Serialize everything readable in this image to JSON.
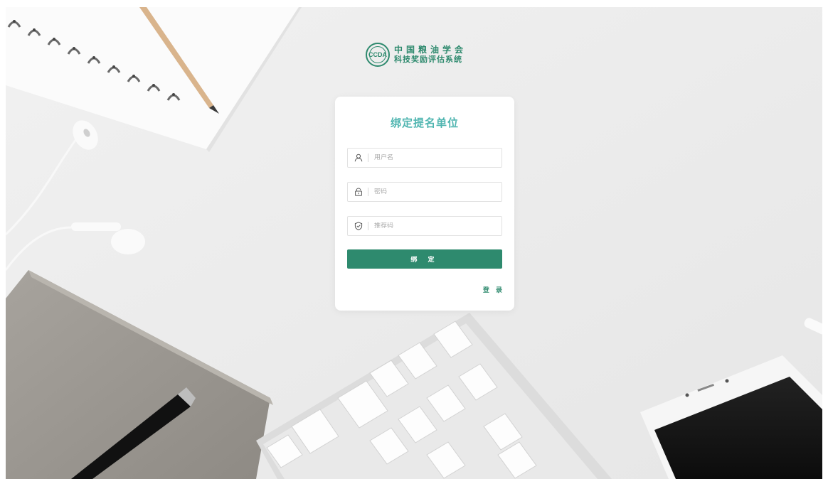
{
  "logo": {
    "seal_text": "CCDA",
    "line1": "中国粮油学会",
    "line2": "科技奖励评估系统"
  },
  "form": {
    "title": "绑定提名单位",
    "username_placeholder": "用户名",
    "password_placeholder": "密码",
    "code_placeholder": "推荐码",
    "bind_label": "绑 定",
    "login_label": "登 录"
  },
  "colors": {
    "brand_green": "#2e8a6e",
    "title_teal": "#4fb5b0",
    "background": "#eeeeee"
  },
  "icons": [
    "user-icon",
    "lock-icon",
    "shield-check-icon"
  ]
}
